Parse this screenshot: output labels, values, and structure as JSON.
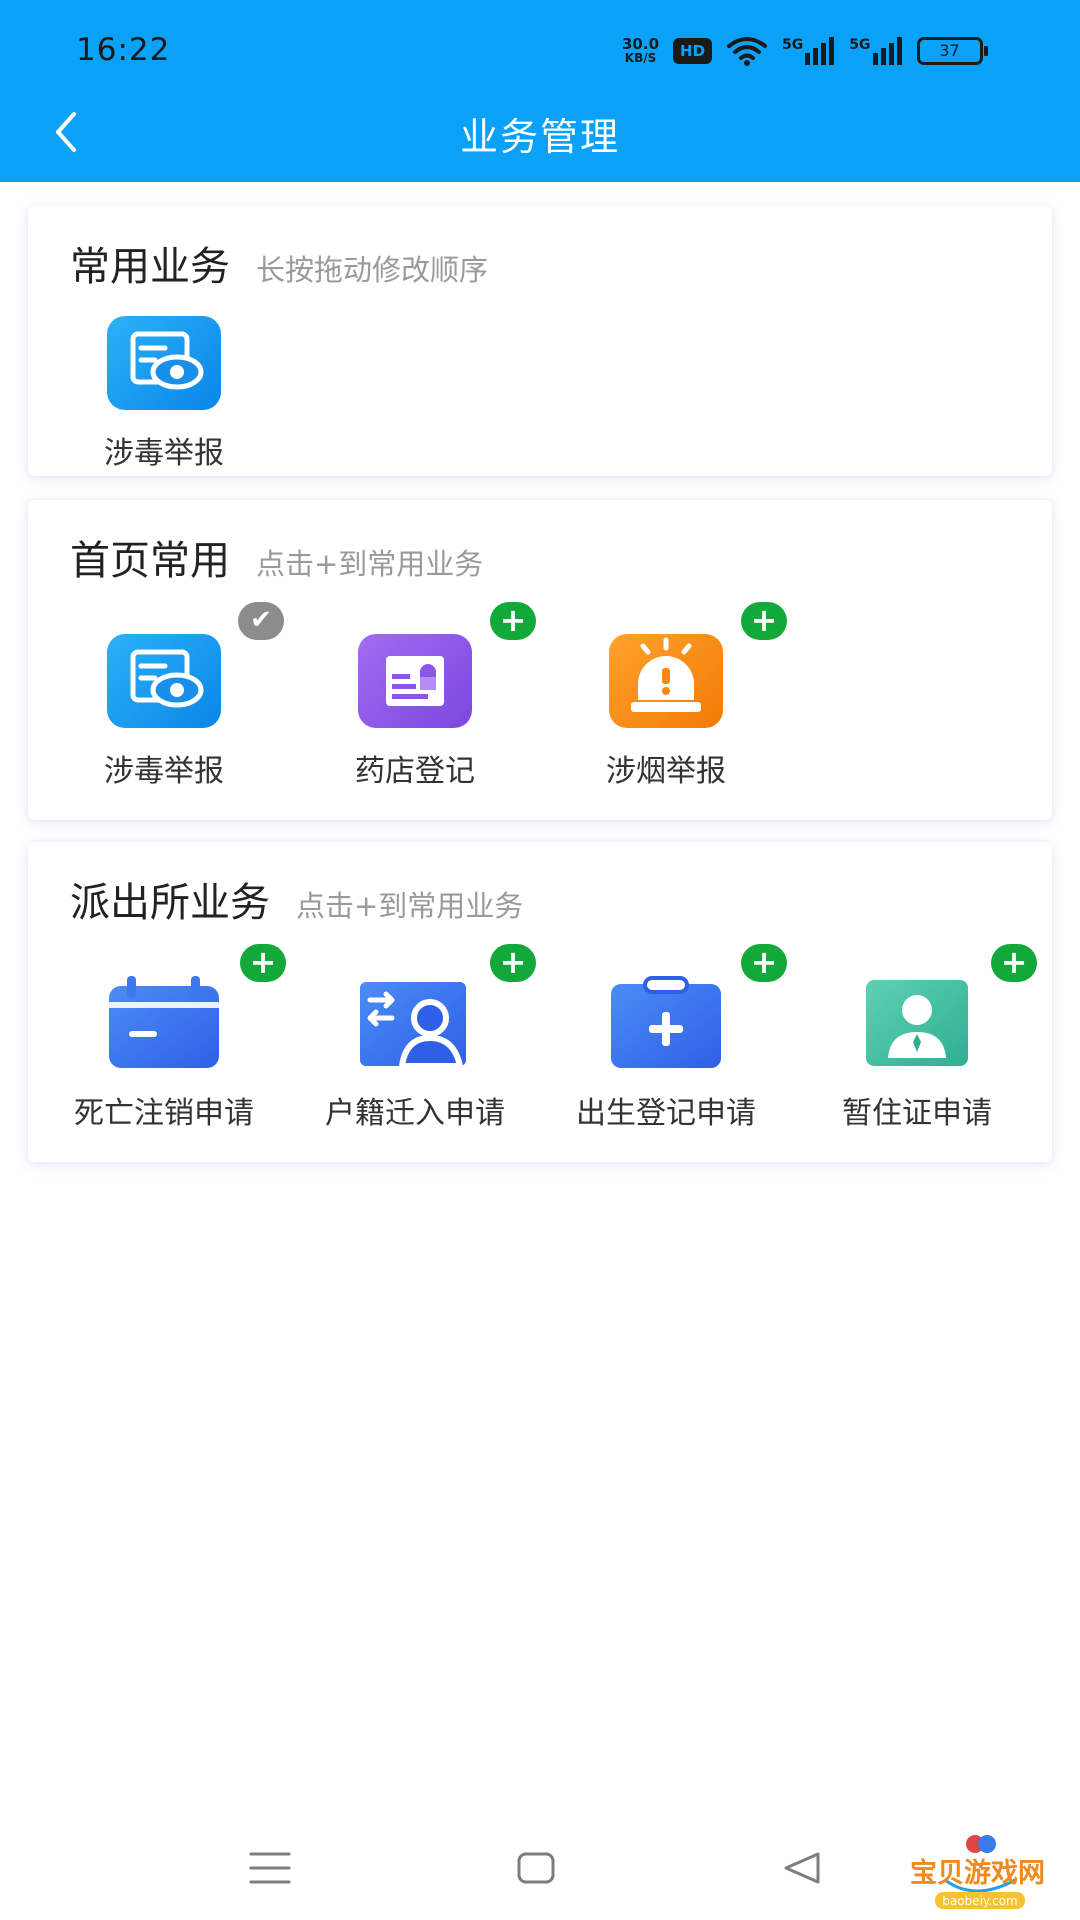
{
  "status_bar": {
    "time": "16:22",
    "net_speed_value": "30.0",
    "net_speed_unit": "KB/S",
    "hd_label": "HD",
    "signal_1": "5G",
    "signal_2": "5G",
    "battery": "37"
  },
  "header": {
    "title": "业务管理",
    "back_icon": "chevron-left-icon"
  },
  "colors": {
    "primary": "#0aa2f9",
    "plus_badge": "#12a83a",
    "check_badge": "#8c8c8c"
  },
  "sections": [
    {
      "title": "常用业务",
      "hint": "长按拖动修改顺序",
      "items": [
        {
          "label": "涉毒举报",
          "icon": "eye-document-icon"
        }
      ]
    },
    {
      "title": "首页常用",
      "hint": "点击+到常用业务",
      "items": [
        {
          "label": "涉毒举报",
          "icon": "eye-document-icon",
          "badge": "✔"
        },
        {
          "label": "药店登记",
          "icon": "id-card-icon",
          "badge": "+"
        },
        {
          "label": "涉烟举报",
          "icon": "alarm-light-icon",
          "badge": "+"
        }
      ]
    },
    {
      "title": "派出所业务",
      "hint": "点击+到常用业务",
      "items": [
        {
          "label": "死亡注销申请",
          "icon": "calendar-minus-icon",
          "badge": "+"
        },
        {
          "label": "户籍迁入申请",
          "icon": "transfer-person-icon",
          "badge": "+"
        },
        {
          "label": "出生登记申请",
          "icon": "clipboard-plus-icon",
          "badge": "+"
        },
        {
          "label": "暂住证申请",
          "icon": "person-tie-icon",
          "badge": "+"
        }
      ]
    }
  ],
  "system_nav": {
    "menu_icon": "menu-icon",
    "home_icon": "home-square-icon",
    "back_icon": "back-triangle-icon"
  },
  "watermark": {
    "name": "宝贝游戏网",
    "domain": "baobeiy.com"
  }
}
